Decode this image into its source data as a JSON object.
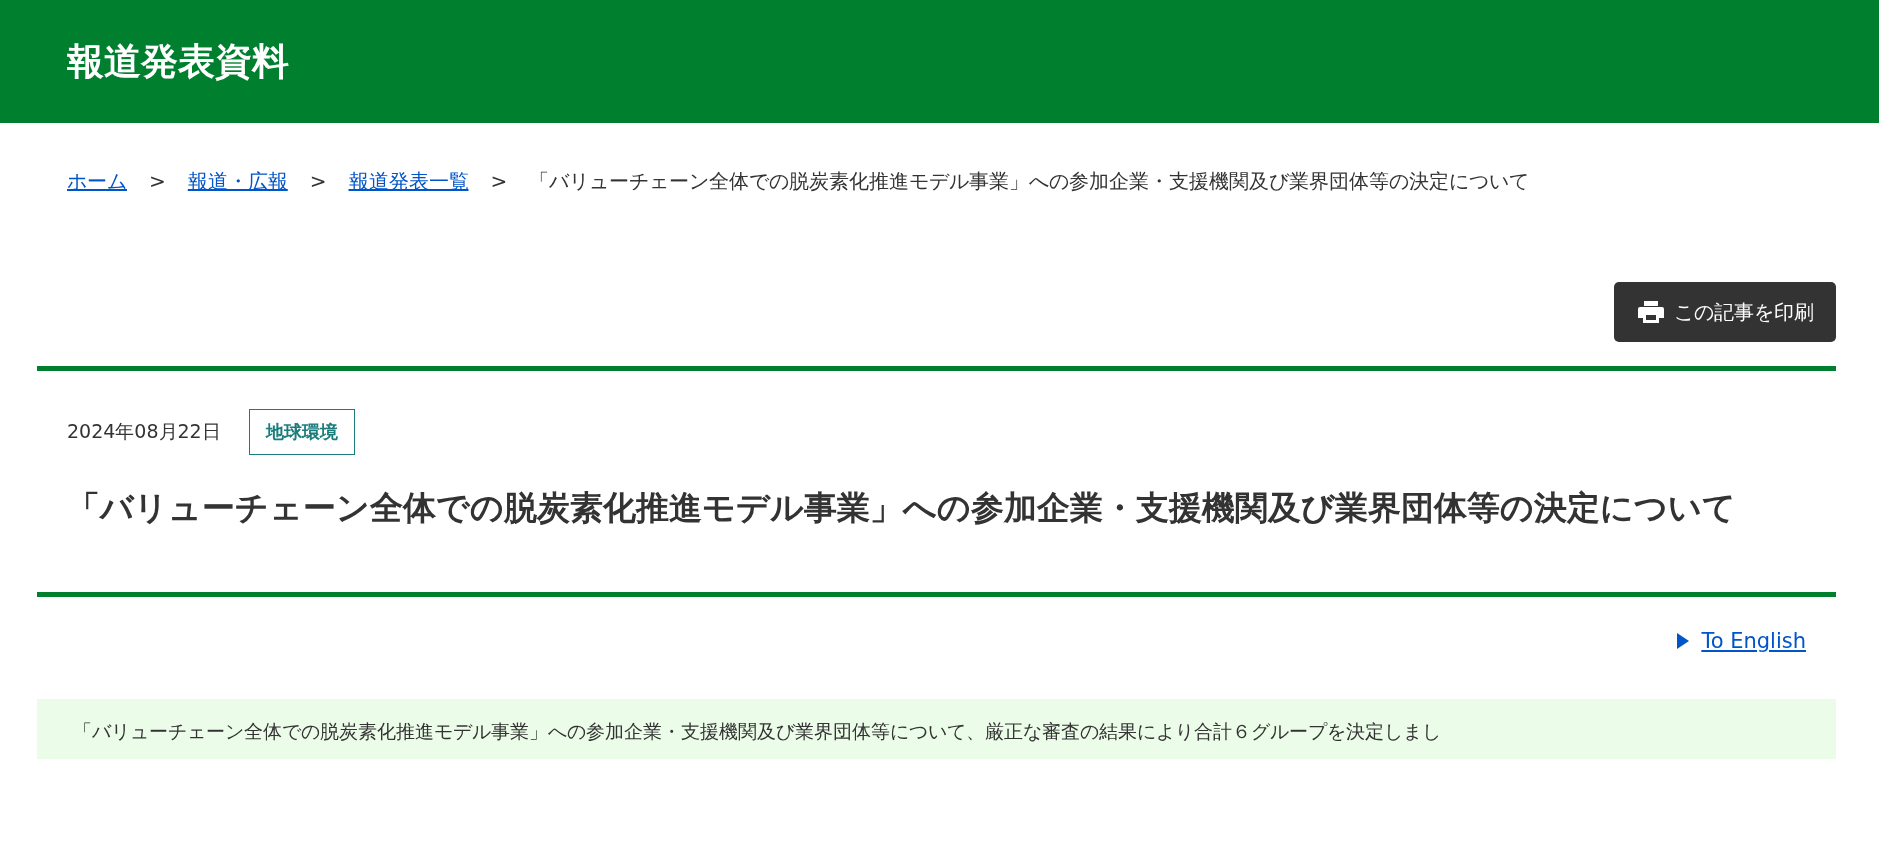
{
  "header": {
    "title": "報道発表資料"
  },
  "breadcrumb": [
    {
      "label": "ホーム",
      "kind": "link"
    },
    {
      "label": "報道・広報",
      "kind": "link"
    },
    {
      "label": "報道発表一覧",
      "kind": "link"
    },
    {
      "label": "「バリューチェーン全体での脱炭素化推進モデル事業」への参加企業・支援機関及び業界団体等の決定について",
      "kind": "current"
    }
  ],
  "breadcrumb_separator": ">",
  "print_button": {
    "label": "この記事を印刷"
  },
  "article": {
    "date": "2024年08月22日",
    "tag": "地球環境",
    "title": "「バリューチェーン全体での脱炭素化推進モデル事業」への参加企業・支援機関及び業界団体等の決定について"
  },
  "language_link": {
    "label": "To English"
  },
  "summary": {
    "text": "「バリューチェーン全体での脱炭素化推進モデル事業」への参加企業・支援機関及び業界団体等について、厳正な審査の結果により合計６グループを決定しまし"
  }
}
